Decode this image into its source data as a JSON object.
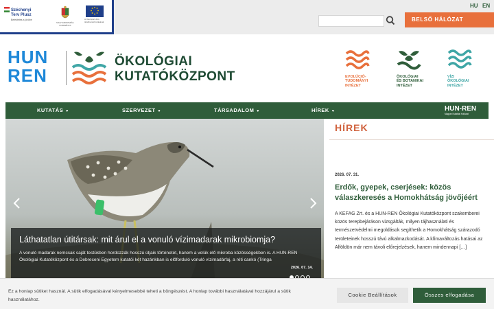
{
  "funding": {
    "szechenyi_title": "Széchenyi Terv Plusz",
    "szechenyi_sub": "Befektetés a jövőbe",
    "hungary_label": "MAGYARORSZÁG KORMÁNYA",
    "eu_label": "Az Európai Unió társfinanszírozásával"
  },
  "lang": {
    "hu": "HU",
    "en": "EN"
  },
  "search": {
    "placeholder": ""
  },
  "internal_button": "BELSŐ HÁLÓZAT",
  "brand": {
    "hun": "HUN",
    "ren": "REN",
    "title_line1": "ÖKOLÓGIAI",
    "title_line2": "KUTATÓKÖZPONT"
  },
  "institutes": [
    {
      "label": [
        "EVOLÚCIÓ-",
        "TUDOMÁNYI",
        "INTÉZET"
      ],
      "color": "#e8703c"
    },
    {
      "label": [
        "ÖKOLÓGIAI",
        "ÉS BOTANIKAI",
        "INTÉZET"
      ],
      "color": "#2f5d3a"
    },
    {
      "label": [
        "VÍZI",
        "ÖKOLÓGIAI",
        "INTÉZET"
      ],
      "color": "#3fa6a6"
    }
  ],
  "nav": {
    "items": [
      "KUTATÁS",
      "SZERVEZET",
      "TÁRSADALOM",
      "HÍREK"
    ],
    "logo_main": "HUN-REN",
    "logo_sub": "Magyar Kutatási Hálózat"
  },
  "slider": {
    "title": "Láthatatlan útitársak: mit árul el a vonuló vízimadarak mikrobiomja?",
    "text": "A vonuló madarak nemcsak saját testükben hordozzák hosszú útjaik történetét, hanem a velük élő mikroba közösségekben is. A HUN-REN Ökológiai Kutatóközpont és a Debreceni Egyetem kutatói két hazánkban is előforduló vonuló vízimadárfaj, a réti cankó (Tringa",
    "date": "2026. 07. 14.",
    "slide_count": 4,
    "active_slide": 1
  },
  "news": {
    "heading": "HÍREK",
    "date": "2026. 07. 31.",
    "title": "Erdők, gyepek, cserjések: közös válaszkeresés a Homokhátság jövőjéért",
    "text": "A KEFAG Zrt. és a HUN-REN Ökológiai Kutatóközpont szakemberei közös terepbejáráson vizsgálták, milyen tájhasználati és természetvédelmi megoldások segíthetik a Homokhátság szárazodó területeinek hosszú távú alkalmazkodását. A klímaváltozás hatásai az Alföldön már nem távoli előrejelzések, hanem mindennapi […]"
  },
  "cookie": {
    "text": "Ez a honlap sütiket használ. A sütik elfogadásával kényelmesebbé teheti a böngészést. A honlap további használatával hozzájárul a sütik használatához.",
    "settings": "Cookie Beállítások",
    "accept": "Összes elfogadása"
  },
  "colors": {
    "green": "#2f5d3a",
    "orange": "#e8703c",
    "blue": "#1e88d8",
    "teal": "#3fa6a6"
  }
}
